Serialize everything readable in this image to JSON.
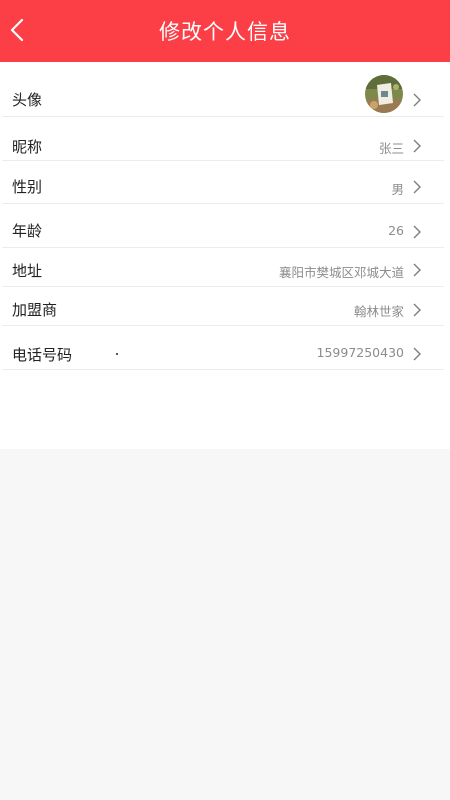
{
  "header": {
    "title": "修改个人信息",
    "back_icon": "chevron-left-icon",
    "color": "#fc3f47"
  },
  "profile": {
    "avatar": {
      "label": "头像"
    },
    "nickname": {
      "label": "昵称",
      "value": "张三"
    },
    "gender": {
      "label": "性别",
      "value": "男"
    },
    "age": {
      "label": "年龄",
      "value": "26"
    },
    "address": {
      "label": "地址",
      "value": "襄阳市樊城区邓城大道"
    },
    "franchisee": {
      "label": "加盟商",
      "value": "翰林世家"
    },
    "phone": {
      "label": "电话号码",
      "value": "15997250430"
    }
  }
}
